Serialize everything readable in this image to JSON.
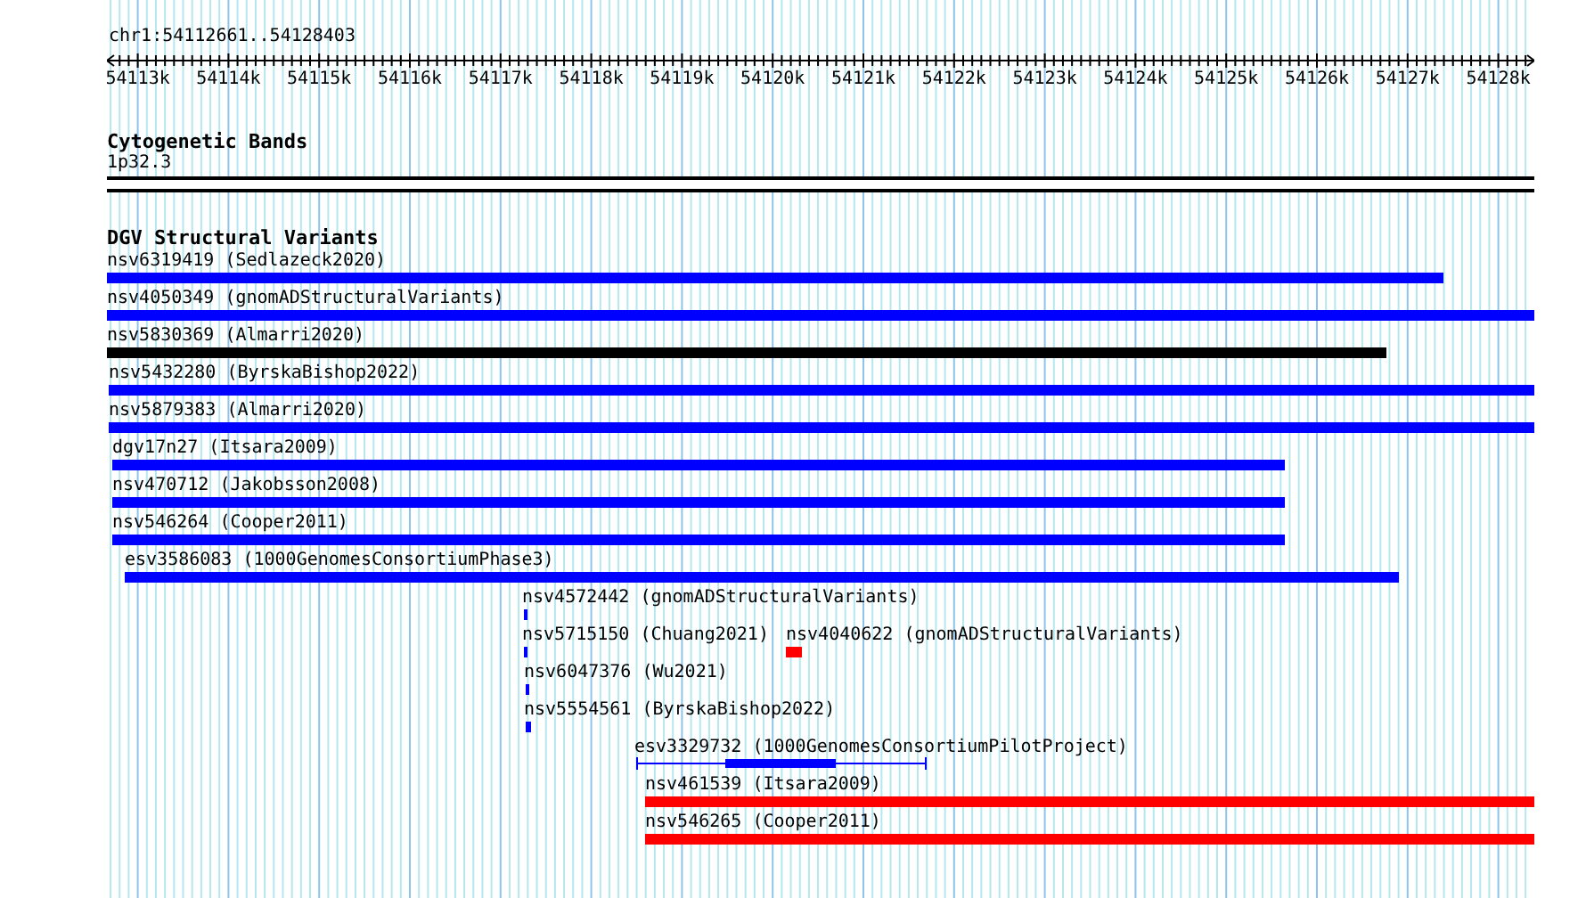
{
  "ruler": {
    "range": "chr1:54112661..54128403",
    "ticks": [
      "54113k",
      "54114k",
      "54115k",
      "54116k",
      "54117k",
      "54118k",
      "54119k",
      "54120k",
      "54121k",
      "54122k",
      "54123k",
      "54124k",
      "54125k",
      "54126k",
      "54127k",
      "54128k"
    ]
  },
  "cytogenetic_bands": {
    "title": "Cytogenetic Bands",
    "band": "1p32.3"
  },
  "dgv_structural_variants": {
    "title": "DGV Structural Variants",
    "rows": [
      {
        "features": [
          {
            "label": "nsv6319419 (Sedlazeck2020)",
            "color": "#0000ff",
            "kind": "bar"
          }
        ]
      },
      {
        "features": [
          {
            "label": "nsv4050349 (gnomADStructuralVariants)",
            "color": "#0000ff",
            "kind": "bar"
          }
        ]
      },
      {
        "features": [
          {
            "label": "nsv5830369 (Almarri2020)",
            "color": "#000000",
            "kind": "bar"
          }
        ]
      },
      {
        "features": [
          {
            "label": "nsv5432280 (ByrskaBishop2022)",
            "color": "#0000ff",
            "kind": "bar"
          }
        ]
      },
      {
        "features": [
          {
            "label": "nsv5879383 (Almarri2020)",
            "color": "#0000ff",
            "kind": "bar"
          }
        ]
      },
      {
        "features": [
          {
            "label": "dgv17n27 (Itsara2009)",
            "color": "#0000ff",
            "kind": "bar"
          }
        ]
      },
      {
        "features": [
          {
            "label": "nsv470712 (Jakobsson2008)",
            "color": "#0000ff",
            "kind": "bar"
          }
        ]
      },
      {
        "features": [
          {
            "label": "nsv546264 (Cooper2011)",
            "color": "#0000ff",
            "kind": "bar"
          }
        ]
      },
      {
        "features": [
          {
            "label": "esv3586083 (1000GenomesConsortiumPhase3)",
            "color": "#0000ff",
            "kind": "bar"
          }
        ]
      },
      {
        "features": [
          {
            "label": "nsv4572442 (gnomADStructuralVariants)",
            "color": "#0000ff",
            "kind": "bar"
          }
        ]
      },
      {
        "features": [
          {
            "label": "nsv5715150 (Chuang2021)",
            "color": "#0000ff",
            "kind": "bar"
          },
          {
            "label": "nsv4040622 (gnomADStructuralVariants)",
            "color": "#ff0000",
            "kind": "bar"
          }
        ]
      },
      {
        "features": [
          {
            "label": "nsv6047376 (Wu2021)",
            "color": "#0000ff",
            "kind": "bar"
          }
        ]
      },
      {
        "features": [
          {
            "label": "nsv5554561 (ByrskaBishop2022)",
            "color": "#0000ff",
            "kind": "bar"
          }
        ]
      },
      {
        "features": [
          {
            "label": "esv3329732 (1000GenomesConsortiumPilotProject)",
            "color": "#0000ff",
            "kind": "gapped"
          }
        ]
      },
      {
        "features": [
          {
            "label": "nsv461539 (Itsara2009)",
            "color": "#ff0000",
            "kind": "bar"
          }
        ]
      },
      {
        "features": [
          {
            "label": "nsv546265 (Cooper2011)",
            "color": "#ff0000",
            "kind": "bar"
          }
        ]
      }
    ]
  }
}
